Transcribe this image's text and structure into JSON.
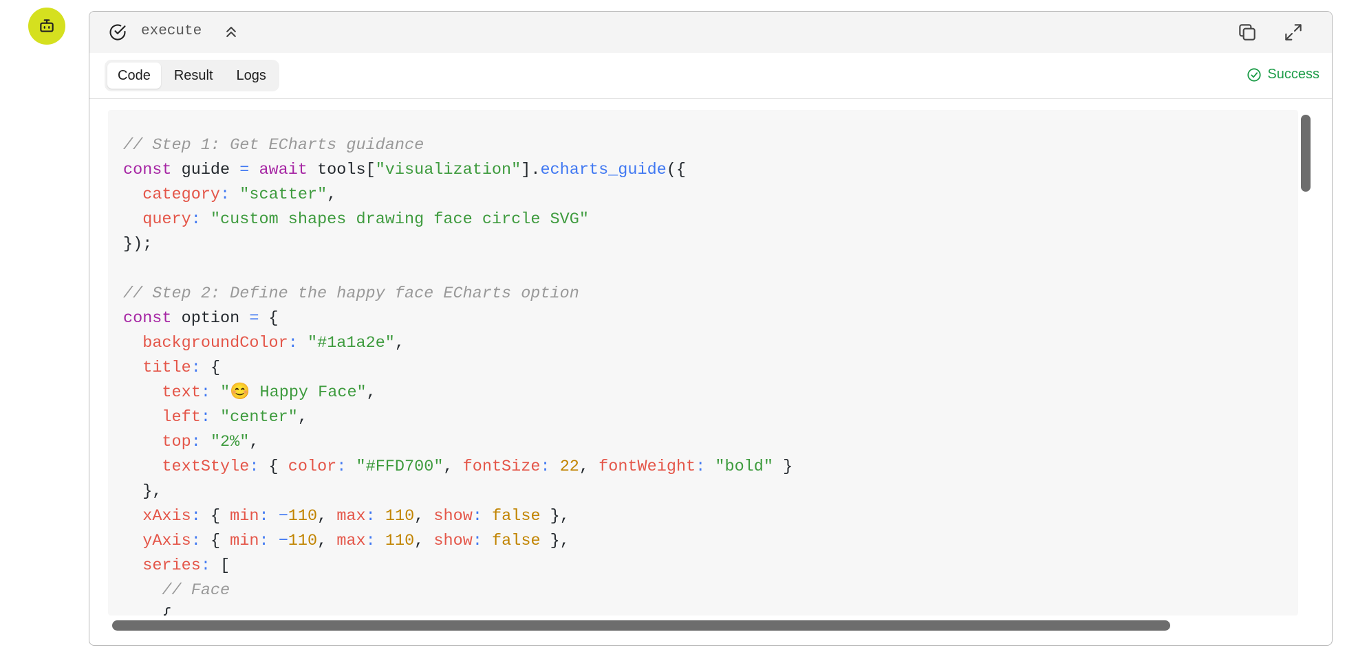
{
  "assistant": {
    "avatar_icon": "robot-icon",
    "avatar_color": "#d5e01f"
  },
  "tool": {
    "name": "execute",
    "status_icon": "check-circle-icon",
    "collapse_icon": "chevrons-up-icon",
    "copy_icon": "copy-icon",
    "expand_icon": "expand-icon"
  },
  "tabs": [
    {
      "label": "Code",
      "active": true
    },
    {
      "label": "Result",
      "active": false
    },
    {
      "label": "Logs",
      "active": false
    }
  ],
  "status": {
    "label": "Success",
    "color": "#1f9d4a",
    "icon": "check-circle-icon"
  },
  "code": {
    "lines": [
      [
        [
          "c",
          "// Step 1: Get ECharts guidance"
        ]
      ],
      [
        [
          "k",
          "const"
        ],
        [
          "t",
          " guide "
        ],
        [
          "o",
          "="
        ],
        [
          "t",
          " "
        ],
        [
          "k",
          "await"
        ],
        [
          "t",
          " tools["
        ],
        [
          "s",
          "\"visualization\""
        ],
        [
          "t",
          "]."
        ],
        [
          "f",
          "echarts_guide"
        ],
        [
          "t",
          "({"
        ]
      ],
      [
        [
          "t",
          "  "
        ],
        [
          "p",
          "category"
        ],
        [
          "o",
          ":"
        ],
        [
          "t",
          " "
        ],
        [
          "s",
          "\"scatter\""
        ],
        [
          "t",
          ","
        ]
      ],
      [
        [
          "t",
          "  "
        ],
        [
          "p",
          "query"
        ],
        [
          "o",
          ":"
        ],
        [
          "t",
          " "
        ],
        [
          "s",
          "\"custom shapes drawing face circle SVG\""
        ]
      ],
      [
        [
          "t",
          "});"
        ]
      ],
      [
        [
          "t",
          ""
        ]
      ],
      [
        [
          "c",
          "// Step 2: Define the happy face ECharts option"
        ]
      ],
      [
        [
          "k",
          "const"
        ],
        [
          "t",
          " option "
        ],
        [
          "o",
          "="
        ],
        [
          "t",
          " {"
        ]
      ],
      [
        [
          "t",
          "  "
        ],
        [
          "p",
          "backgroundColor"
        ],
        [
          "o",
          ":"
        ],
        [
          "t",
          " "
        ],
        [
          "s",
          "\"#1a1a2e\""
        ],
        [
          "t",
          ","
        ]
      ],
      [
        [
          "t",
          "  "
        ],
        [
          "p",
          "title"
        ],
        [
          "o",
          ":"
        ],
        [
          "t",
          " {"
        ]
      ],
      [
        [
          "t",
          "    "
        ],
        [
          "p",
          "text"
        ],
        [
          "o",
          ":"
        ],
        [
          "t",
          " "
        ],
        [
          "s",
          "\"😊 Happy Face\""
        ],
        [
          "t",
          ","
        ]
      ],
      [
        [
          "t",
          "    "
        ],
        [
          "p",
          "left"
        ],
        [
          "o",
          ":"
        ],
        [
          "t",
          " "
        ],
        [
          "s",
          "\"center\""
        ],
        [
          "t",
          ","
        ]
      ],
      [
        [
          "t",
          "    "
        ],
        [
          "p",
          "top"
        ],
        [
          "o",
          ":"
        ],
        [
          "t",
          " "
        ],
        [
          "s",
          "\"2%\""
        ],
        [
          "t",
          ","
        ]
      ],
      [
        [
          "t",
          "    "
        ],
        [
          "p",
          "textStyle"
        ],
        [
          "o",
          ":"
        ],
        [
          "t",
          " { "
        ],
        [
          "p",
          "color"
        ],
        [
          "o",
          ":"
        ],
        [
          "t",
          " "
        ],
        [
          "s",
          "\"#FFD700\""
        ],
        [
          "t",
          ", "
        ],
        [
          "p",
          "fontSize"
        ],
        [
          "o",
          ":"
        ],
        [
          "t",
          " "
        ],
        [
          "n",
          "22"
        ],
        [
          "t",
          ", "
        ],
        [
          "p",
          "fontWeight"
        ],
        [
          "o",
          ":"
        ],
        [
          "t",
          " "
        ],
        [
          "s",
          "\"bold\""
        ],
        [
          "t",
          " }"
        ]
      ],
      [
        [
          "t",
          "  },"
        ]
      ],
      [
        [
          "t",
          "  "
        ],
        [
          "p",
          "xAxis"
        ],
        [
          "o",
          ":"
        ],
        [
          "t",
          " { "
        ],
        [
          "p",
          "min"
        ],
        [
          "o",
          ":"
        ],
        [
          "t",
          " "
        ],
        [
          "o",
          "−"
        ],
        [
          "n",
          "110"
        ],
        [
          "t",
          ", "
        ],
        [
          "p",
          "max"
        ],
        [
          "o",
          ":"
        ],
        [
          "t",
          " "
        ],
        [
          "n",
          "110"
        ],
        [
          "t",
          ", "
        ],
        [
          "p",
          "show"
        ],
        [
          "o",
          ":"
        ],
        [
          "t",
          " "
        ],
        [
          "n",
          "false"
        ],
        [
          "t",
          " },"
        ]
      ],
      [
        [
          "t",
          "  "
        ],
        [
          "p",
          "yAxis"
        ],
        [
          "o",
          ":"
        ],
        [
          "t",
          " { "
        ],
        [
          "p",
          "min"
        ],
        [
          "o",
          ":"
        ],
        [
          "t",
          " "
        ],
        [
          "o",
          "−"
        ],
        [
          "n",
          "110"
        ],
        [
          "t",
          ", "
        ],
        [
          "p",
          "max"
        ],
        [
          "o",
          ":"
        ],
        [
          "t",
          " "
        ],
        [
          "n",
          "110"
        ],
        [
          "t",
          ", "
        ],
        [
          "p",
          "show"
        ],
        [
          "o",
          ":"
        ],
        [
          "t",
          " "
        ],
        [
          "n",
          "false"
        ],
        [
          "t",
          " },"
        ]
      ],
      [
        [
          "t",
          "  "
        ],
        [
          "p",
          "series"
        ],
        [
          "o",
          ":"
        ],
        [
          "t",
          " ["
        ]
      ],
      [
        [
          "t",
          "    "
        ],
        [
          "c",
          "// Face"
        ]
      ],
      [
        [
          "t",
          "    {"
        ]
      ]
    ]
  }
}
